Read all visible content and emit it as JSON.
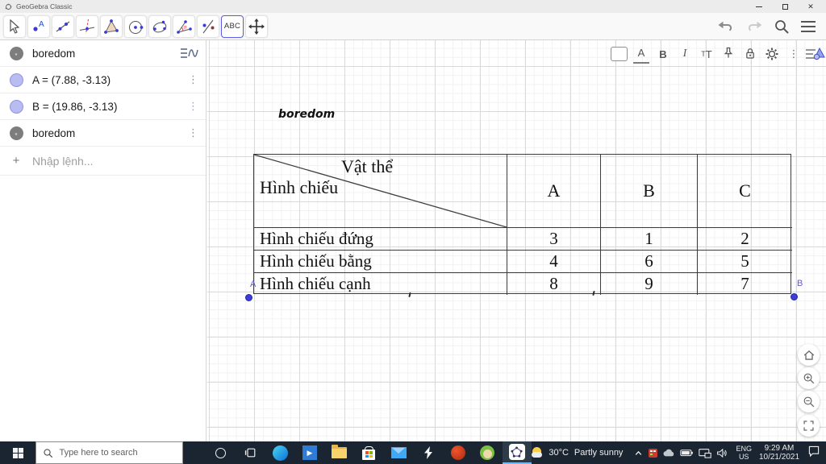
{
  "window": {
    "title": "GeoGebra Classic",
    "close_glyph": "✕"
  },
  "colors": {
    "accent_selected_tool": "#5d5de0",
    "point_fill": "#b9bcf0",
    "point_object": "#3d3dd8",
    "taskbar_bg": "#1b2531",
    "active_app_underline": "#76b9ed"
  },
  "toolbar": {
    "text_tool_label": "ABC",
    "tools": [
      "move",
      "point",
      "line",
      "perpendicular-line",
      "polygon",
      "circle-with-center",
      "conic",
      "angle",
      "reflection",
      "text",
      "move-graphics-view"
    ],
    "right_icons": [
      "undo",
      "redo",
      "search",
      "menu"
    ]
  },
  "algebra": {
    "rows": [
      {
        "type": "text",
        "text": "boredom"
      },
      {
        "type": "point",
        "text": "A = (7.88, -3.13)"
      },
      {
        "type": "point",
        "text": "B = (19.86, -3.13)"
      },
      {
        "type": "text",
        "text": "boredom"
      }
    ],
    "input_placeholder": "Nhập lệnh...",
    "add_glyph": "+",
    "more_glyph": "⋮",
    "text_object_glyph": "”"
  },
  "stylebar": {
    "color_label": "A",
    "bold_label": "B",
    "italic_label": "I",
    "size_small": "T",
    "size_big": "T",
    "more_glyph": "⋮"
  },
  "canvas": {
    "text_label": "boredom",
    "points": [
      {
        "label": "A",
        "coords": "(7.88, -3.13)"
      },
      {
        "label": "B",
        "coords": "(19.86, -3.13)"
      }
    ]
  },
  "table": {
    "corner_top": "Vật thể",
    "corner_bottom": "Hình chiếu",
    "columns": [
      "A",
      "B",
      "C"
    ],
    "rows": [
      {
        "label": "Hình chiếu đứng",
        "values": [
          "3",
          "1",
          "2"
        ]
      },
      {
        "label": "Hình chiếu bằng",
        "values": [
          "4",
          "6",
          "5"
        ]
      },
      {
        "label": "Hình chiếu cạnh",
        "values": [
          "8",
          "9",
          "7"
        ]
      }
    ]
  },
  "taskbar": {
    "search_placeholder": "Type here to search",
    "weather": {
      "temperature": "30°C",
      "condition": "Partly sunny"
    },
    "language": {
      "line1": "ENG",
      "line2": "US"
    },
    "clock": {
      "time": "9:29 AM",
      "date": "10/21/2021"
    }
  }
}
